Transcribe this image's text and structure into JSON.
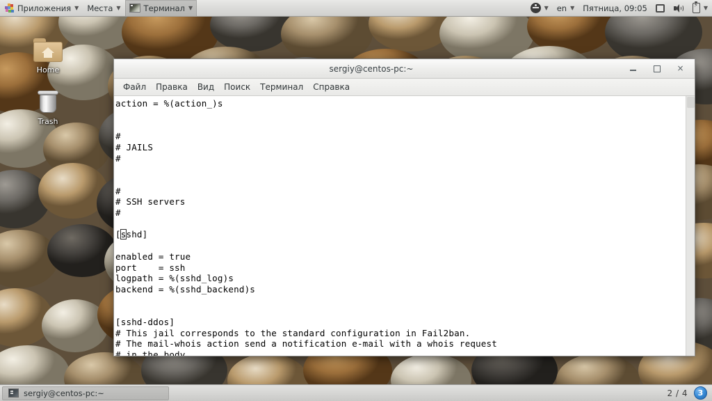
{
  "top_panel": {
    "applications_label": "Приложения",
    "places_label": "Места",
    "terminal_label": "Терминал",
    "keyboard_layout": "en",
    "clock": "Пятница, 09:05"
  },
  "desktop": {
    "icons": [
      {
        "label": "Home",
        "icon": "home-folder-icon"
      },
      {
        "label": "Trash",
        "icon": "trash-can-icon"
      }
    ]
  },
  "window": {
    "title": "sergiy@centos-pc:~",
    "buttons": {
      "minimize": "–",
      "maximize": "□",
      "close": "×"
    },
    "menu": [
      "Файл",
      "Правка",
      "Вид",
      "Поиск",
      "Терминал",
      "Справка"
    ],
    "terminal": {
      "lines_before_cursor": "action = %(action_)s\n\n\n#\n# JAILS\n#\n\n\n#\n# SSH servers\n#\n\n[",
      "cursor_char": "s",
      "lines_after_cursor": "shd]\n\nenabled = true\nport    = ssh\nlogpath = %(sshd_log)s\nbackend = %(sshd_backend)s\n\n\n[sshd-ddos]\n# This jail corresponds to the standard configuration in Fail2ban.\n# The mail-whois action send a notification e-mail with a whois request\n# in the body."
    }
  },
  "bottom_panel": {
    "task_label": "sergiy@centos-pc:~",
    "workspace": "2 / 4",
    "notification_count": "3"
  },
  "colors": {
    "panel_bg": "#dcdcda",
    "window_bg": "#ffffff",
    "text": "#000000",
    "badge_blue": "#3a8dd8"
  }
}
